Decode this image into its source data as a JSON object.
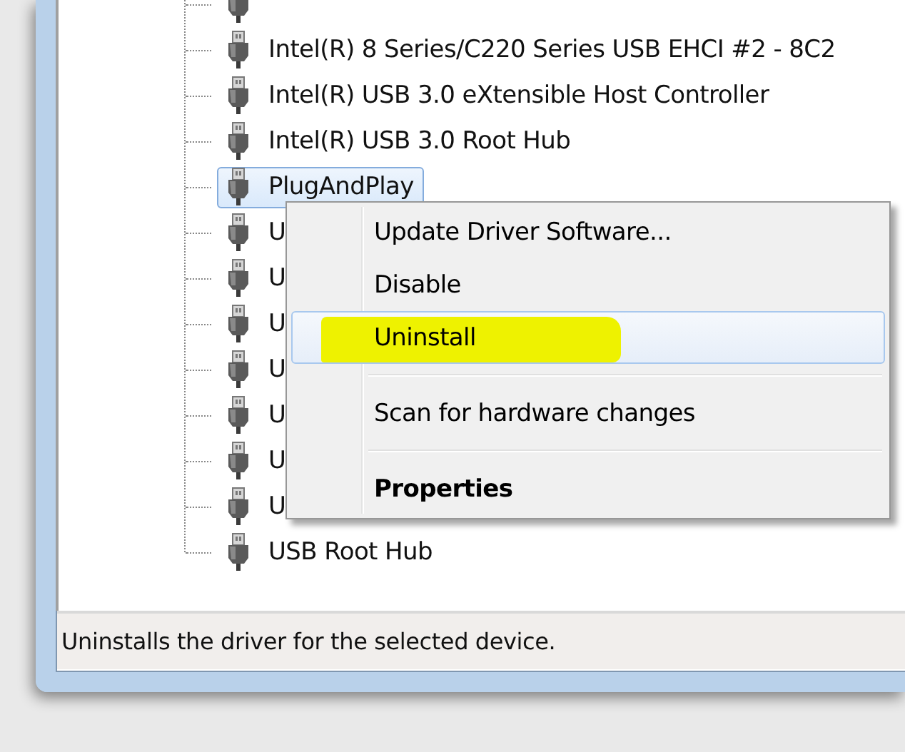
{
  "tree": {
    "items": [
      {
        "kind": "cut"
      },
      {
        "kind": "device",
        "label": "Intel(R) 8 Series/C220 Series USB EHCI #2 - 8C2",
        "selected": false
      },
      {
        "kind": "device",
        "label": "Intel(R) USB 3.0 eXtensible Host Controller",
        "selected": false
      },
      {
        "kind": "device",
        "label": "Intel(R) USB 3.0 Root Hub",
        "selected": false
      },
      {
        "kind": "device",
        "label": "PlugAndPlay",
        "selected": true
      },
      {
        "kind": "device",
        "label": "U",
        "selected": false
      },
      {
        "kind": "device",
        "label": "U",
        "selected": false
      },
      {
        "kind": "device",
        "label": "U",
        "selected": false
      },
      {
        "kind": "device",
        "label": "U",
        "selected": false
      },
      {
        "kind": "device",
        "label": "U",
        "selected": false
      },
      {
        "kind": "device",
        "label": "U",
        "selected": false
      },
      {
        "kind": "device",
        "label": "U",
        "selected": false
      },
      {
        "kind": "device",
        "label": "USB Root Hub",
        "selected": false
      }
    ]
  },
  "context_menu": {
    "items": [
      {
        "kind": "item",
        "label": "Update Driver Software...",
        "selected": false,
        "bold": false,
        "marked": false
      },
      {
        "kind": "item",
        "label": "Disable",
        "selected": false,
        "bold": false,
        "marked": false
      },
      {
        "kind": "item",
        "label": "Uninstall",
        "selected": true,
        "bold": false,
        "marked": true
      },
      {
        "kind": "separator"
      },
      {
        "kind": "item",
        "label": "Scan for hardware changes",
        "selected": false,
        "bold": false,
        "marked": false
      },
      {
        "kind": "separator"
      },
      {
        "kind": "item",
        "label": "Properties",
        "selected": false,
        "bold": true,
        "marked": false
      }
    ]
  },
  "status_bar": {
    "text": "Uninstalls the driver for the selected device."
  }
}
